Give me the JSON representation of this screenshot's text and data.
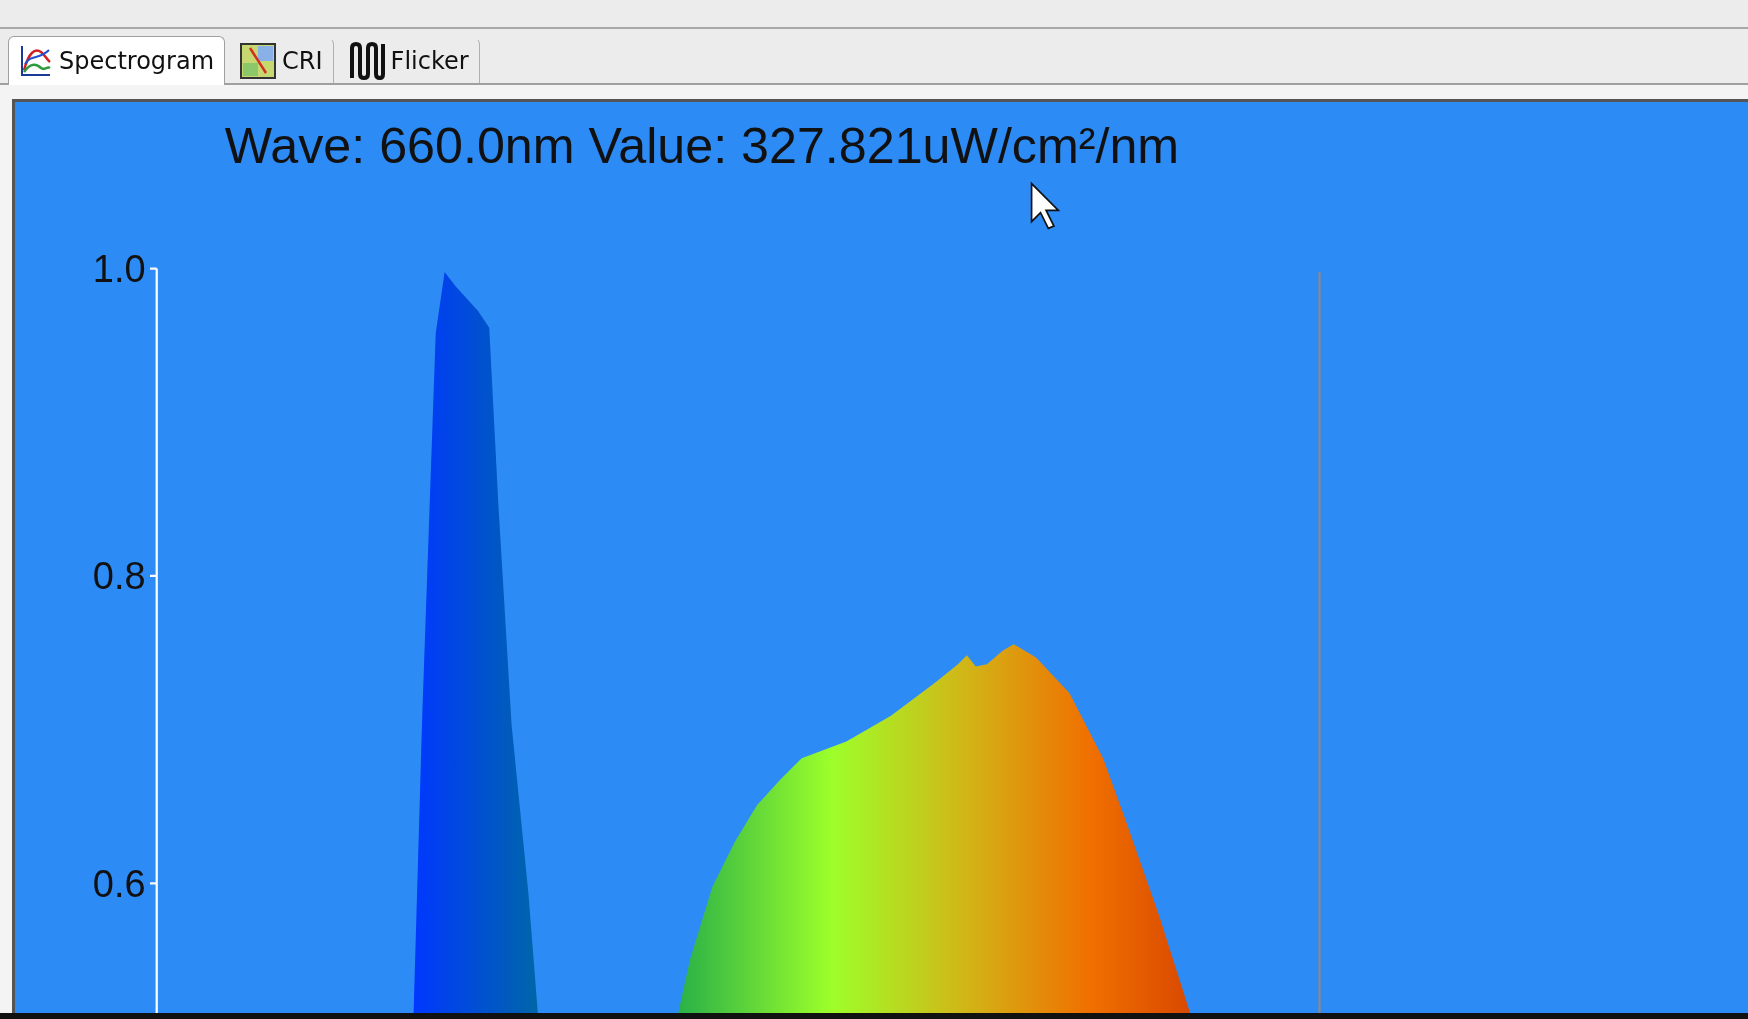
{
  "tabs": [
    {
      "label": "Spectrogram",
      "kind": "spectrum",
      "selected": true
    },
    {
      "label": "CRI",
      "kind": "cri",
      "selected": false
    },
    {
      "label": "Flicker",
      "kind": "flicker",
      "selected": false
    }
  ],
  "plot": {
    "readout": "Wave: 660.0nm Value: 327.821uW/cm²/nm",
    "y_ticks": [
      "1.0",
      "0.8",
      "0.6"
    ]
  }
}
